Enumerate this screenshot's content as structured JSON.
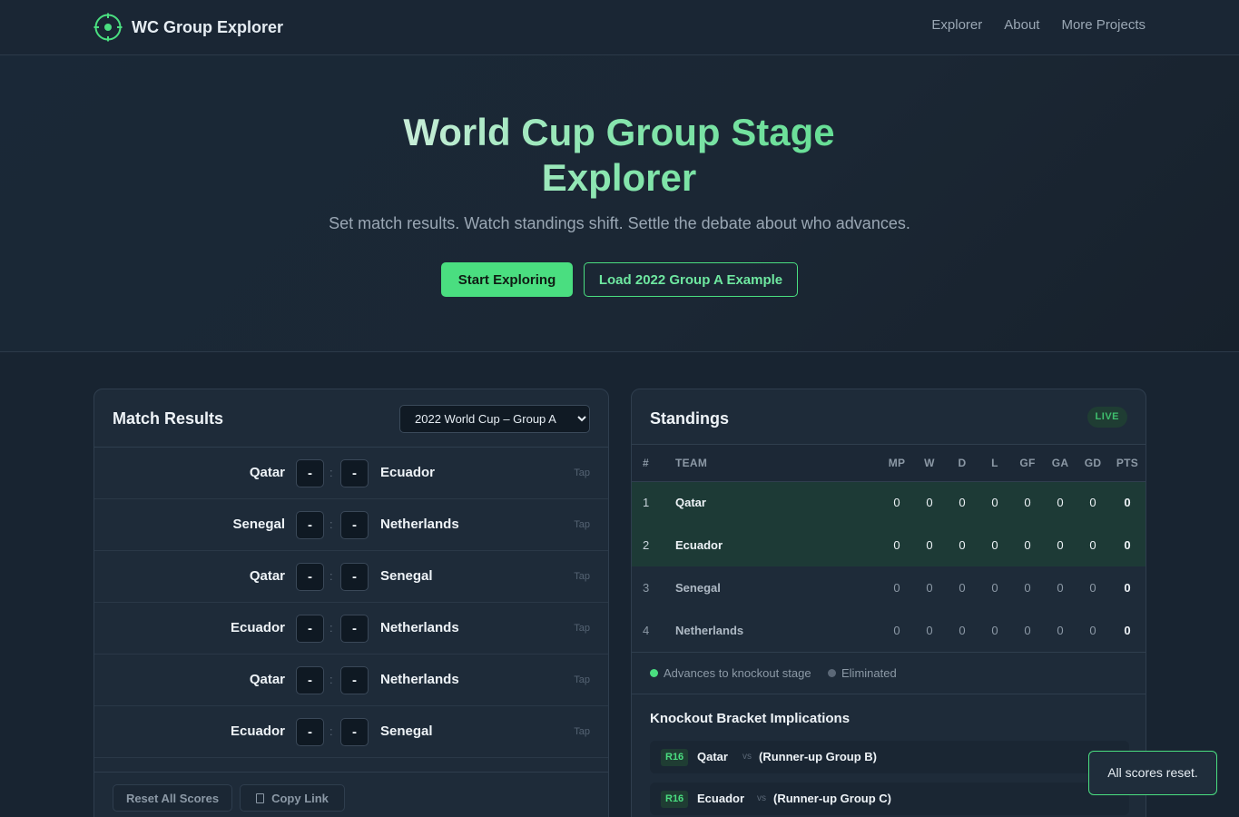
{
  "nav": {
    "brand": "WC Group Explorer",
    "links": [
      "Explorer",
      "About",
      "More Projects"
    ]
  },
  "hero": {
    "title_line1": "World Cup Group Stage",
    "title_line2": "Explorer",
    "subtitle": "Set match results. Watch standings shift. Settle the debate about who advances.",
    "primary_button": "Start Exploring",
    "secondary_button": "Load 2022 Group A Example"
  },
  "matches": {
    "title": "Match Results",
    "selected_group": "2022 World Cup – Group A",
    "rows": [
      {
        "home": "Qatar",
        "away": "Ecuador",
        "home_score": "-",
        "away_score": "-",
        "sep": ":",
        "hint": "Tap"
      },
      {
        "home": "Senegal",
        "away": "Netherlands",
        "home_score": "-",
        "away_score": "-",
        "sep": ":",
        "hint": "Tap"
      },
      {
        "home": "Qatar",
        "away": "Senegal",
        "home_score": "-",
        "away_score": "-",
        "sep": ":",
        "hint": "Tap"
      },
      {
        "home": "Ecuador",
        "away": "Netherlands",
        "home_score": "-",
        "away_score": "-",
        "sep": ":",
        "hint": "Tap"
      },
      {
        "home": "Qatar",
        "away": "Netherlands",
        "home_score": "-",
        "away_score": "-",
        "sep": ":",
        "hint": "Tap"
      },
      {
        "home": "Ecuador",
        "away": "Senegal",
        "home_score": "-",
        "away_score": "-",
        "sep": ":",
        "hint": "Tap"
      }
    ],
    "reset_button": "Reset All Scores",
    "copy_button": "Copy Link"
  },
  "standings": {
    "title": "Standings",
    "badge": "LIVE",
    "columns": [
      "#",
      "TEAM",
      "MP",
      "W",
      "D",
      "L",
      "GF",
      "GA",
      "GD",
      "PTS"
    ],
    "rows": [
      {
        "pos": "1",
        "team": "Qatar",
        "mp": "0",
        "w": "0",
        "d": "0",
        "l": "0",
        "gf": "0",
        "ga": "0",
        "gd": "0",
        "pts": "0",
        "status": "advances"
      },
      {
        "pos": "2",
        "team": "Ecuador",
        "mp": "0",
        "w": "0",
        "d": "0",
        "l": "0",
        "gf": "0",
        "ga": "0",
        "gd": "0",
        "pts": "0",
        "status": "advances"
      },
      {
        "pos": "3",
        "team": "Senegal",
        "mp": "0",
        "w": "0",
        "d": "0",
        "l": "0",
        "gf": "0",
        "ga": "0",
        "gd": "0",
        "pts": "0",
        "status": "eliminated"
      },
      {
        "pos": "4",
        "team": "Netherlands",
        "mp": "0",
        "w": "0",
        "d": "0",
        "l": "0",
        "gf": "0",
        "ga": "0",
        "gd": "0",
        "pts": "0",
        "status": "eliminated"
      }
    ],
    "legend_advances": "Advances to knockout stage",
    "legend_eliminated": "Eliminated"
  },
  "knockout": {
    "title": "Knockout Bracket Implications",
    "rows": [
      {
        "badge": "R16",
        "team": "Qatar",
        "vs": "vs",
        "opponent": "(Runner-up Group B)"
      },
      {
        "badge": "R16",
        "team": "Ecuador",
        "vs": "vs",
        "opponent": "(Runner-up Group C)"
      }
    ]
  },
  "toast": "All scores reset.",
  "colors": {
    "accent": "#4ade80",
    "background": "#182431",
    "panel": "#1e2b39",
    "advance_row": "#1d3a36"
  }
}
